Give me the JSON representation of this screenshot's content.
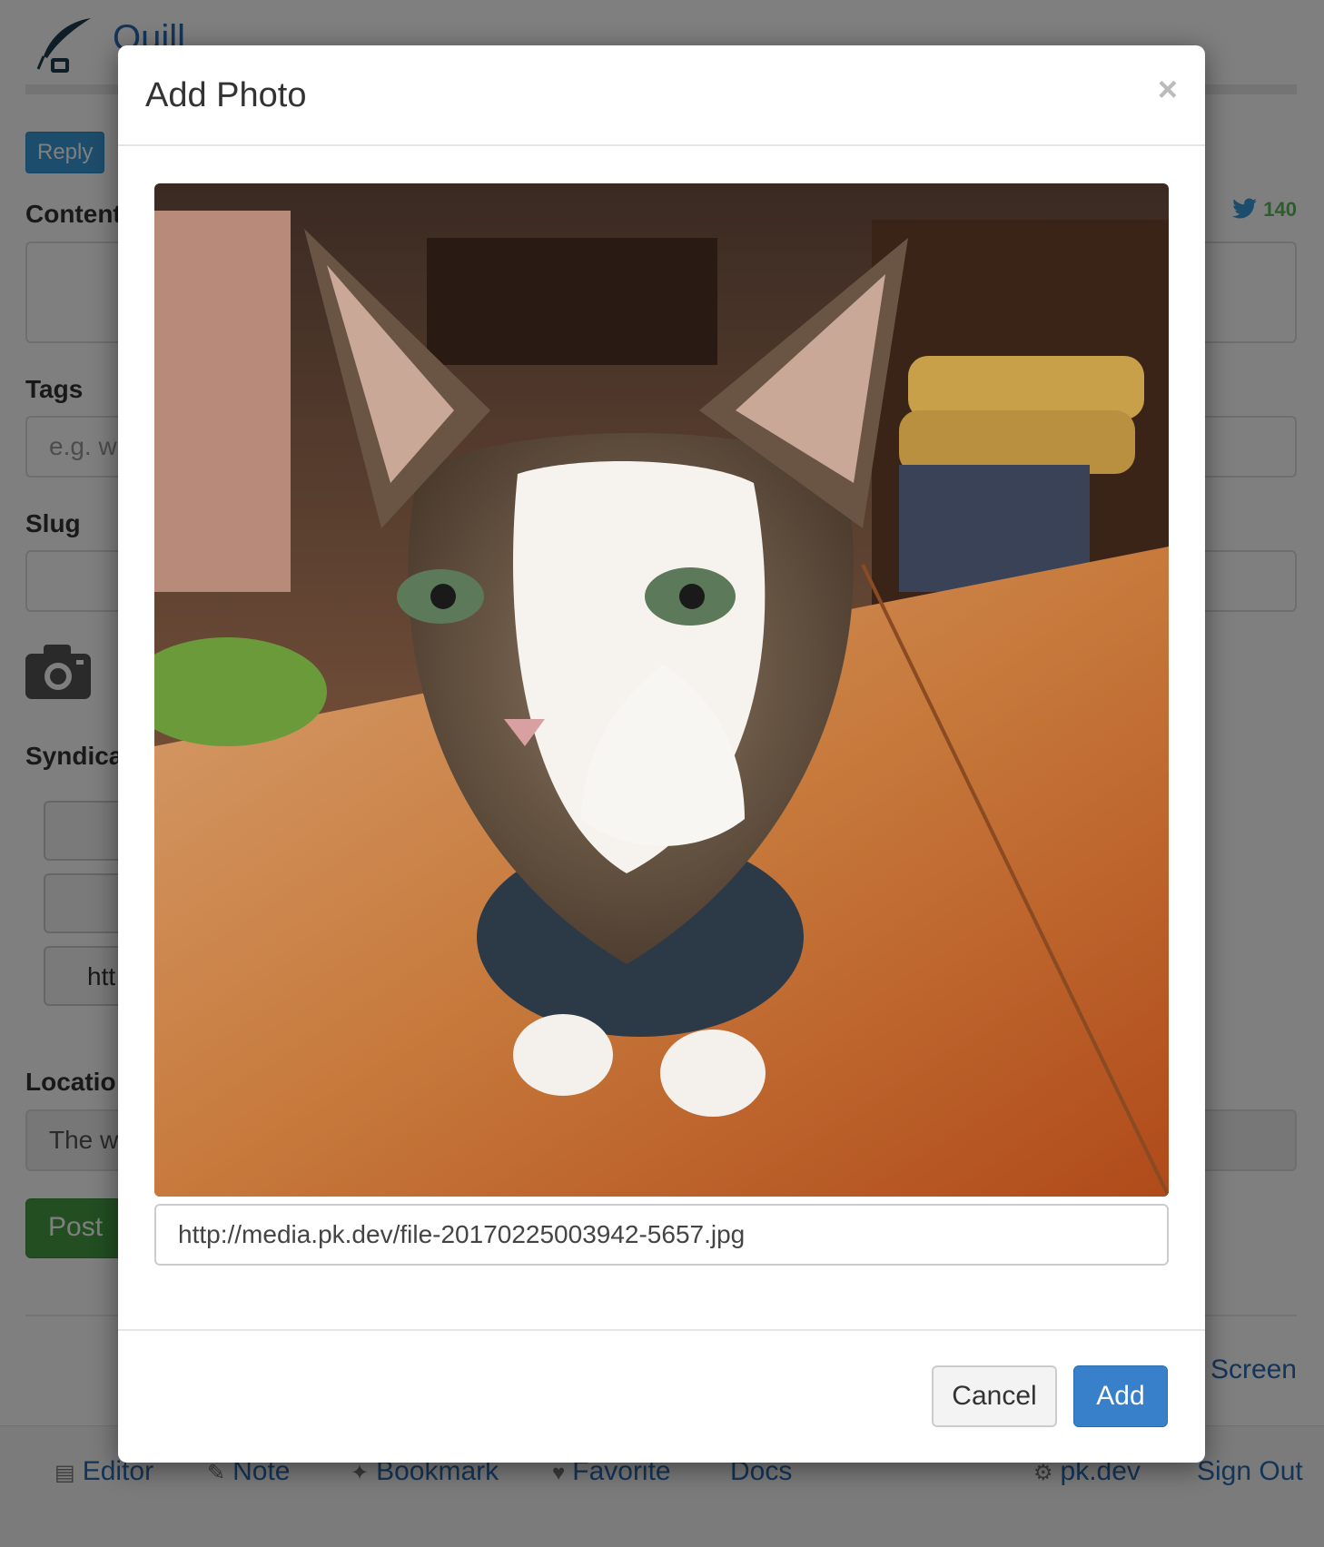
{
  "app": {
    "title": "Quill"
  },
  "reply_button": "Reply",
  "content": {
    "label": "Content",
    "counter": "140",
    "counter_icon": "twitter-bird-icon"
  },
  "tags": {
    "label": "Tags",
    "placeholder": "e.g. w"
  },
  "slug": {
    "label": "Slug"
  },
  "syndicate": {
    "label": "Syndica",
    "third_button_text": "htt"
  },
  "location": {
    "label": "Locatio",
    "value": "The w"
  },
  "post_button": "Post",
  "fullscreen_link": "e Screen",
  "footer": {
    "items": [
      {
        "label": "Editor",
        "icon": "document-icon"
      },
      {
        "label": "Note",
        "icon": "pencil-icon"
      },
      {
        "label": "Bookmark",
        "icon": "pin-icon"
      },
      {
        "label": "Favorite",
        "icon": "thumbs-up-icon"
      },
      {
        "label": "Docs"
      },
      {
        "label": "pk.dev",
        "icon": "gear-icon"
      },
      {
        "label": "Sign Out"
      }
    ]
  },
  "modal": {
    "title": "Add Photo",
    "close_symbol": "×",
    "photo_url": "http://media.pk.dev/file-20170225003942-5657.jpg",
    "cancel_label": "Cancel",
    "add_label": "Add"
  },
  "colors": {
    "link": "#2a6ab0",
    "primary": "#3880c9",
    "success": "#449d44",
    "info": "#3a9bd9"
  }
}
